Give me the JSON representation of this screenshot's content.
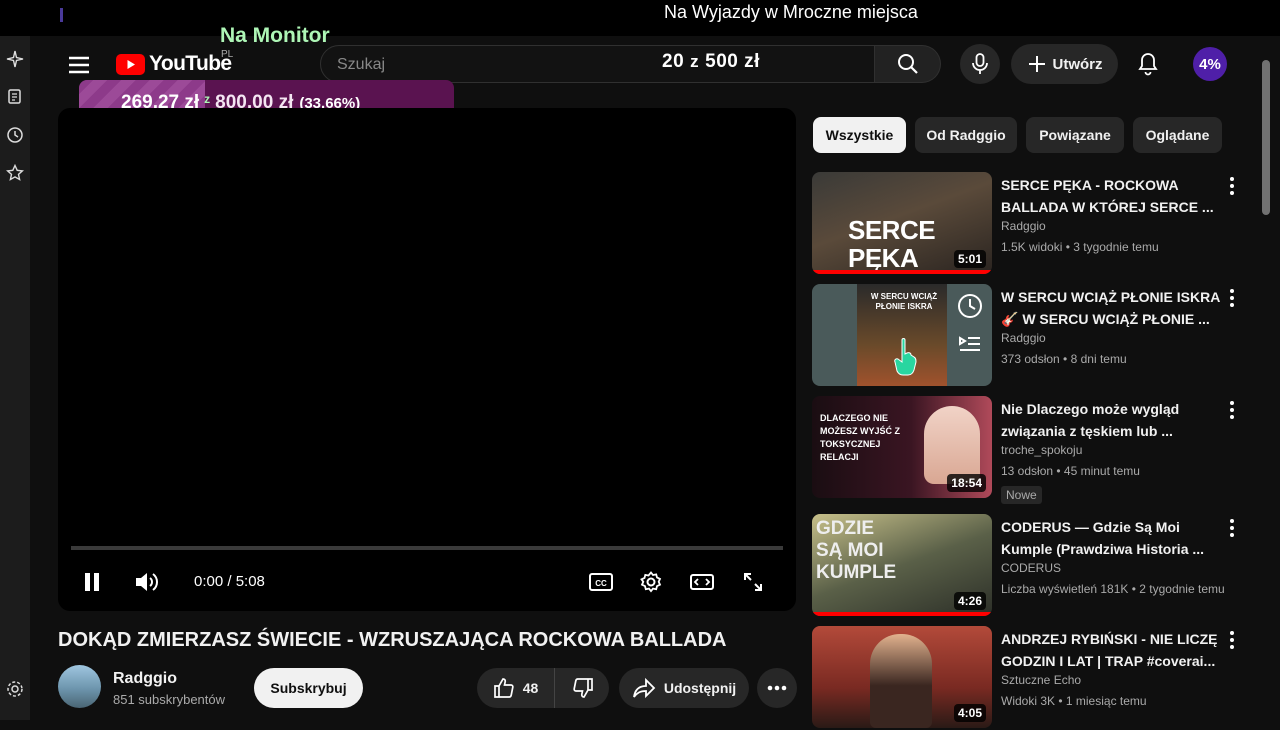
{
  "overlay": {
    "top_text": "Na Wyjazdy w Mroczne miejsca",
    "label": "Na Monitor",
    "goal_current": "20",
    "goal_sep": "z",
    "goal_target": "500 zł",
    "donation_current": "269,27 zł",
    "donation_sep": "z",
    "donation_goal": "800,00 zł",
    "donation_percent": "(33.66%)",
    "donation_fraction": 0.3366,
    "badge_percent": "4%"
  },
  "header": {
    "logo_text": "YouTube",
    "region": "PL",
    "search_placeholder": "Szukaj",
    "create_label": "Utwórz"
  },
  "player": {
    "time": "0:00 / 5:08",
    "progress_fraction": 0.0
  },
  "video": {
    "title": "DOKĄD ZMIERZASZ ŚWIECIE - WZRUSZAJĄCA ROCKOWA BALLADA",
    "channel": "Radggio",
    "subscribers": "851 subskrybentów",
    "subscribe_label": "Subskrybuj",
    "likes": "48",
    "share_label": "Udostępnij"
  },
  "chips": [
    "Wszystkie",
    "Od Radggio",
    "Powiązane",
    "Oglądane"
  ],
  "recommendations": [
    {
      "title": "SERCE PĘKA - ROCKOWA BALLADA W KTÓREJ SERCE ...",
      "channel": "Radggio",
      "meta": "1.5K widoki • 3 tygodnie temu",
      "duration": "5:01",
      "thumb_text": "SERCE PĘKA",
      "watched": 1.0
    },
    {
      "title": "W SERCU WCIĄŻ PŁONIE ISKRA 🎸 W SERCU WCIĄŻ PŁONIE ...",
      "channel": "Radggio",
      "meta": "373 odsłon • 8 dni temu",
      "duration": "",
      "thumb_text": "W SERCU WCIĄŻ PŁONIE ISKRA",
      "watched": 0.0
    },
    {
      "title": "Nie Dlaczego może wygląd związania z tęskiem lub ...",
      "channel": "troche_spokoju",
      "meta": "13 odsłon • 45 minut temu",
      "duration": "18:54",
      "badge": "Nowe",
      "thumb_text": "DLACZEGO NIE MOŻESZ WYJŚĆ Z TOKSYCZNEJ RELACJI",
      "watched": 0.0
    },
    {
      "title": "CODERUS — Gdzie Są Moi Kumple (Prawdziwa Historia ...",
      "channel": "CODERUS",
      "meta": "Liczba wyświetleń 181K • 2 tygodnie temu",
      "duration": "4:26",
      "thumb_text": "GDZIE SĄ MOI KUMPLE",
      "watched": 1.0
    },
    {
      "title": "ANDRZEJ RYBIŃSKI - NIE LICZĘ GODZIN I LAT | TRAP #coverai...",
      "channel": "Sztuczne Echo",
      "meta": "Widoki 3K • 1 miesiąc temu",
      "duration": "4:05",
      "thumb_text": "",
      "watched": 0.0
    }
  ],
  "colors": {
    "accent": "#ff0000",
    "overlay_purple": "#5a1350",
    "overlay_green": "#aef6b6",
    "badge_purple": "#4f1fa8"
  },
  "icons": {
    "menu": "hamburger-icon",
    "search": "search-icon",
    "mic": "mic-icon",
    "create": "plus-icon",
    "bell": "bell-icon",
    "play": "pause-icon",
    "volume": "volume-icon",
    "cc": "cc-icon",
    "settings": "gear-icon",
    "theater": "theater-icon",
    "fullscreen": "fullscreen-icon"
  }
}
